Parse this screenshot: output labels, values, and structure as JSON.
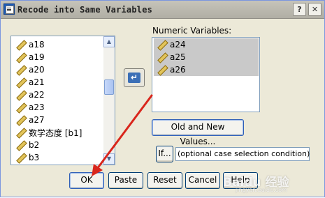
{
  "window": {
    "title": "Recode into Same Variables",
    "help_glyph": "?",
    "close_glyph": "✕",
    "app_icon": "spss-dialog-icon"
  },
  "source_list": {
    "items": [
      {
        "label": "a18",
        "icon": "scale-ruler-icon"
      },
      {
        "label": "a19",
        "icon": "scale-ruler-icon"
      },
      {
        "label": "a20",
        "icon": "scale-ruler-icon"
      },
      {
        "label": "a21",
        "icon": "scale-ruler-icon"
      },
      {
        "label": "a22",
        "icon": "scale-ruler-icon"
      },
      {
        "label": "a23",
        "icon": "scale-ruler-icon"
      },
      {
        "label": "a27",
        "icon": "scale-ruler-icon"
      },
      {
        "label": "数学态度 [b1]",
        "icon": "scale-ruler-icon"
      },
      {
        "label": "b2",
        "icon": "scale-ruler-icon"
      },
      {
        "label": "b3",
        "icon": "scale-ruler-icon"
      }
    ]
  },
  "numeric_variables": {
    "label": "Numeric Variables:",
    "items": [
      {
        "label": "a24",
        "icon": "scale-ruler-icon"
      },
      {
        "label": "a25",
        "icon": "scale-ruler-icon"
      },
      {
        "label": "a26",
        "icon": "scale-ruler-icon"
      }
    ]
  },
  "buttons": {
    "move_glyph": "↵",
    "old_new_values": "Old and New Values...",
    "if": "If...",
    "ok": "OK",
    "paste": "Paste",
    "reset": "Reset",
    "cancel": "Cancel",
    "help": "Help"
  },
  "condition": {
    "text": "(optional case selection condition)"
  },
  "watermark": {
    "text": "Baidu 经验",
    "sub": "jingyan.baidu.com"
  },
  "colors": {
    "dialog_bg": "#ece9d8",
    "selected_item_bg": "#c9c9c9",
    "annotation_arrow": "#d9261c"
  }
}
